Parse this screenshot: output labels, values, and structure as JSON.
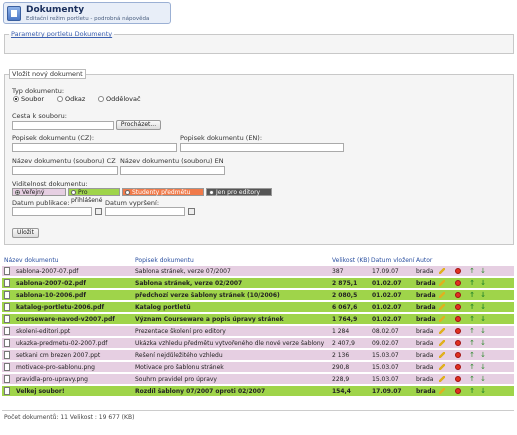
{
  "header": {
    "title": "Dokumenty",
    "subtitle": "Editační režim portletu - podrobná nápověda",
    "icon": "document-icon"
  },
  "params_section": {
    "legend": "Parametry portletu Dokumenty"
  },
  "form": {
    "legend": "Vložit nový dokument",
    "type_label": "Typ dokumentu:",
    "type_options": [
      "Soubor",
      "Odkaz",
      "Oddělovač"
    ],
    "type_selected": "Soubor",
    "path_label": "Cesta k souboru:",
    "browse_button": "Procházet...",
    "desc_cz_label": "Popisek dokumentu (CZ):",
    "desc_en_label": "Popisek dokumentu (EN):",
    "name_cz_label": "Název dokumentu (souboru) CZ",
    "name_en_label": "Název dokumentu (souboru) EN",
    "visibility_label": "Viditelnost dokumentu:",
    "visibility_options": [
      {
        "label": "Veřejný",
        "color": "#e6cfe2",
        "selected": true
      },
      {
        "label": "Pro přihlášené",
        "color": "#9fd44a",
        "selected": false
      },
      {
        "label": "Studenty předmětu",
        "color": "#f07a4a",
        "selected": false
      },
      {
        "label": "Jen pro editory",
        "color": "#555555",
        "selected": false
      }
    ],
    "pub_date_label": "Datum publikace:",
    "exp_date_label": "Datum vypršení:",
    "save_button": "Uložit"
  },
  "table": {
    "headers": {
      "name": "Název dokumentu",
      "desc": "Popisek dokumentu",
      "size": "Velikost (KB)",
      "date": "Datum vložení",
      "author": "Autor"
    },
    "rows": [
      {
        "name": "sablona-2007-07.pdf",
        "desc": "Šablona stránek, verze 07/2007",
        "size": "387",
        "date": "17.09.07",
        "author": "brada",
        "color": "pink"
      },
      {
        "name": "sablona-2007-02.pdf",
        "desc": "Šablona stránek, verze 02/2007",
        "size": "2 875,1",
        "date": "01.02.07",
        "author": "brada",
        "color": "green"
      },
      {
        "name": "sablona-10-2006.pdf",
        "desc": "předchozí verze šablony stránek (10/2006)",
        "size": "2 080,5",
        "date": "01.02.07",
        "author": "brada",
        "color": "green"
      },
      {
        "name": "katalog-portletu-2006.pdf",
        "desc": "Katalog portletů",
        "size": "6 067,6",
        "date": "01.02.07",
        "author": "brada",
        "color": "green"
      },
      {
        "name": "courseware-navod-v2007.pdf",
        "desc": "Význam Courseware a popis úpravy stránek",
        "size": "1 764,9",
        "date": "01.02.07",
        "author": "brada",
        "color": "green"
      },
      {
        "name": "skoleni-editori.ppt",
        "desc": "Prezentace školení pro editory",
        "size": "1 284",
        "date": "08.02.07",
        "author": "brada",
        "color": "pink"
      },
      {
        "name": "ukazka-predmetu-02-2007.pdf",
        "desc": "Ukázka vzhledu předmětu vytvořeného dle nové verze šablony",
        "size": "2 407,9",
        "date": "09.02.07",
        "author": "brada",
        "color": "pink"
      },
      {
        "name": "setkani cm brezen 2007.ppt",
        "desc": "Řešení nejdůležitého vzhledu",
        "size": "2 136",
        "date": "15.03.07",
        "author": "brada",
        "color": "pink"
      },
      {
        "name": "motivace-pro-sablonu.png",
        "desc": "Motivace pro šablonu stránek",
        "size": "290,8",
        "date": "15.03.07",
        "author": "brada",
        "color": "pink"
      },
      {
        "name": "pravidla-pro-upravy.png",
        "desc": "Souhrn pravidel pro úpravy",
        "size": "228,9",
        "date": "15.03.07",
        "author": "brada",
        "color": "pink"
      },
      {
        "name": "Velkej soubor!",
        "desc": "Rozdíl šablony 07/2007 oproti 02/2007",
        "size": "154,4",
        "date": "17.09.07",
        "author": "brada",
        "color": "green"
      }
    ]
  },
  "footer": {
    "summary": "Počet dokumentů: 11 Velikost : 19 677 (KB)"
  }
}
